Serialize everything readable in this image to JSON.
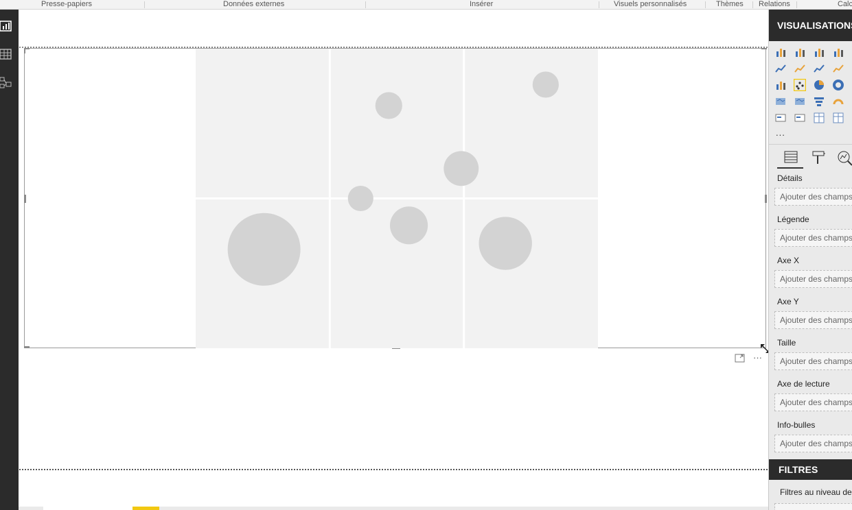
{
  "ribbon": {
    "groups": [
      "Presse-papiers",
      "Données externes",
      "Insérer",
      "Visuels personnalisés",
      "Thèmes",
      "Relations",
      "Calc"
    ]
  },
  "left_rail": {
    "icons": [
      "report-view-icon",
      "data-view-icon",
      "relationships-view-icon"
    ]
  },
  "chart_data": {
    "type": "scatter",
    "placeholder": true,
    "grid": true,
    "points": [
      {
        "x": 0.17,
        "y": 0.33,
        "size": 1.0
      },
      {
        "x": 0.41,
        "y": 0.5,
        "size": 0.35
      },
      {
        "x": 0.48,
        "y": 0.81,
        "size": 0.37
      },
      {
        "x": 0.53,
        "y": 0.41,
        "size": 0.52
      },
      {
        "x": 0.66,
        "y": 0.6,
        "size": 0.48
      },
      {
        "x": 0.77,
        "y": 0.35,
        "size": 0.73
      },
      {
        "x": 0.87,
        "y": 0.88,
        "size": 0.36
      }
    ]
  },
  "visual_actions": {
    "focus_icon": "focus-mode-icon",
    "more_label": "···"
  },
  "pane": {
    "title": "VISUALISATIONS",
    "more_label": "...",
    "viz_icons": [
      "stacked-bar-icon",
      "stacked-column-icon",
      "clustered-bar-icon",
      "clustered-column-icon",
      "line-chart-icon",
      "area-chart-icon",
      "stacked-area-icon",
      "line-column-icon",
      "ribbon-chart-icon",
      "scatter-chart-icon",
      "pie-chart-icon",
      "donut-chart-icon",
      "map-icon",
      "filled-map-icon",
      "funnel-icon",
      "gauge-icon",
      "card-icon",
      "slicer-icon",
      "table-icon",
      "matrix-icon"
    ],
    "selected_viz": 9,
    "tabs": [
      "fields-tab-icon",
      "format-tab-icon",
      "analytics-tab-icon"
    ],
    "wells": [
      {
        "label": "Détails",
        "placeholder": "Ajouter des champs"
      },
      {
        "label": "Légende",
        "placeholder": "Ajouter des champs"
      },
      {
        "label": "Axe X",
        "placeholder": "Ajouter des champs"
      },
      {
        "label": "Axe Y",
        "placeholder": "Ajouter des champs"
      },
      {
        "label": "Taille",
        "placeholder": "Ajouter des champs"
      },
      {
        "label": "Axe de lecture",
        "placeholder": "Ajouter des champs"
      },
      {
        "label": "Info-bulles",
        "placeholder": "Ajouter des champs"
      }
    ],
    "filters_title": "FILTRES",
    "filters_sub": "Filtres au niveau de"
  },
  "colors": {
    "accent_yellow": "#f2c811",
    "dark": "#2b2b2b",
    "plot_bg": "#f2f2f2",
    "bubble": "#d3d3d3"
  }
}
